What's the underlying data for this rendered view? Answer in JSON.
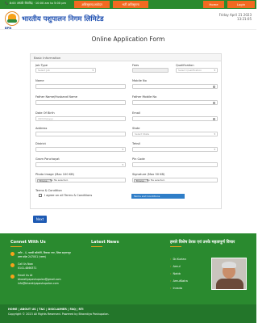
{
  "topbar": {
    "info": "📞 8:00 आपके सेवाकेंद्र · 10:00 am to 5:00 pm",
    "btn1": "अधिसूचना/आवेदन",
    "btn2": "भर्ती अधिसूचना",
    "btn3": "Home",
    "btn4": "Login"
  },
  "header": {
    "logo_text": "BPN",
    "brand": "भारतीय पशुपालन निगम लिमिटेड",
    "date_line1": "Friday April 21 2023",
    "date_line2": "13:21:05"
  },
  "page": {
    "title": "Online Application Form"
  },
  "form": {
    "section_title": "Basic Information",
    "job_type_label": "Job Type",
    "job_type_value": "Select Job",
    "fees_label": "Fees",
    "qualification_label": "Qualification",
    "qualification_value": "Select Qualification",
    "name_label": "Name",
    "mobile_label": "Mobile No",
    "father_name_label": "Father Name/Husband Name",
    "father_mobile_label": "Father Mobile No",
    "dob_label": "Date Of Birth",
    "dob_placeholder": "dd/mm/yyyy",
    "email_label": "Email",
    "address_label": "Address",
    "state_label": "State",
    "state_value": "Select State",
    "district_label": "District",
    "tehsil_label": "Tehsil",
    "gram_label": "Gram Panchayat",
    "pin_label": "Pin Code",
    "photo_label": "Photo Image (Max 100 KB)",
    "signature_label": "Signature (Max 50 KB)",
    "browse": "Browse...",
    "no_file": "No file selected.",
    "terms_heading": "Terms & Condition",
    "terms_agree": "I agree on all Terms & Conditions",
    "terms_button": "Terms and Conditions",
    "next": "Next"
  },
  "footer": {
    "connect_title": "Connet With Us",
    "news_title": "Latest News",
    "address": "प्लॉट - 4, गायत्री कॉलोनी, विकास नगर, जिला सहारनपुर",
    "address2": "उत्तर प्रदेश 247001 (भारत)",
    "phone_label": "Call Us Now",
    "phone": "0141-4866371",
    "email_label": "Email Us At",
    "email1": "bharatiyapashupalan@gmail.com",
    "email2": "info@bharatiyapashupalan.com",
    "hindi_heading": "हमारे विशेष प्रेरक एवं उनके महत्वपूर्ण विचार",
    "links": [
      "Dr.Kurian",
      "Amul",
      "Nabb",
      "AmulKaira",
      "Inrada"
    ]
  },
  "bottombar": {
    "links": "HOME | ABOUT US | T&C | DISCLAIMER | FAQ | RTI",
    "copyright": "Copyright © 2023 All Rights Reserved. Powered by Bharatiya Pashupalan."
  }
}
